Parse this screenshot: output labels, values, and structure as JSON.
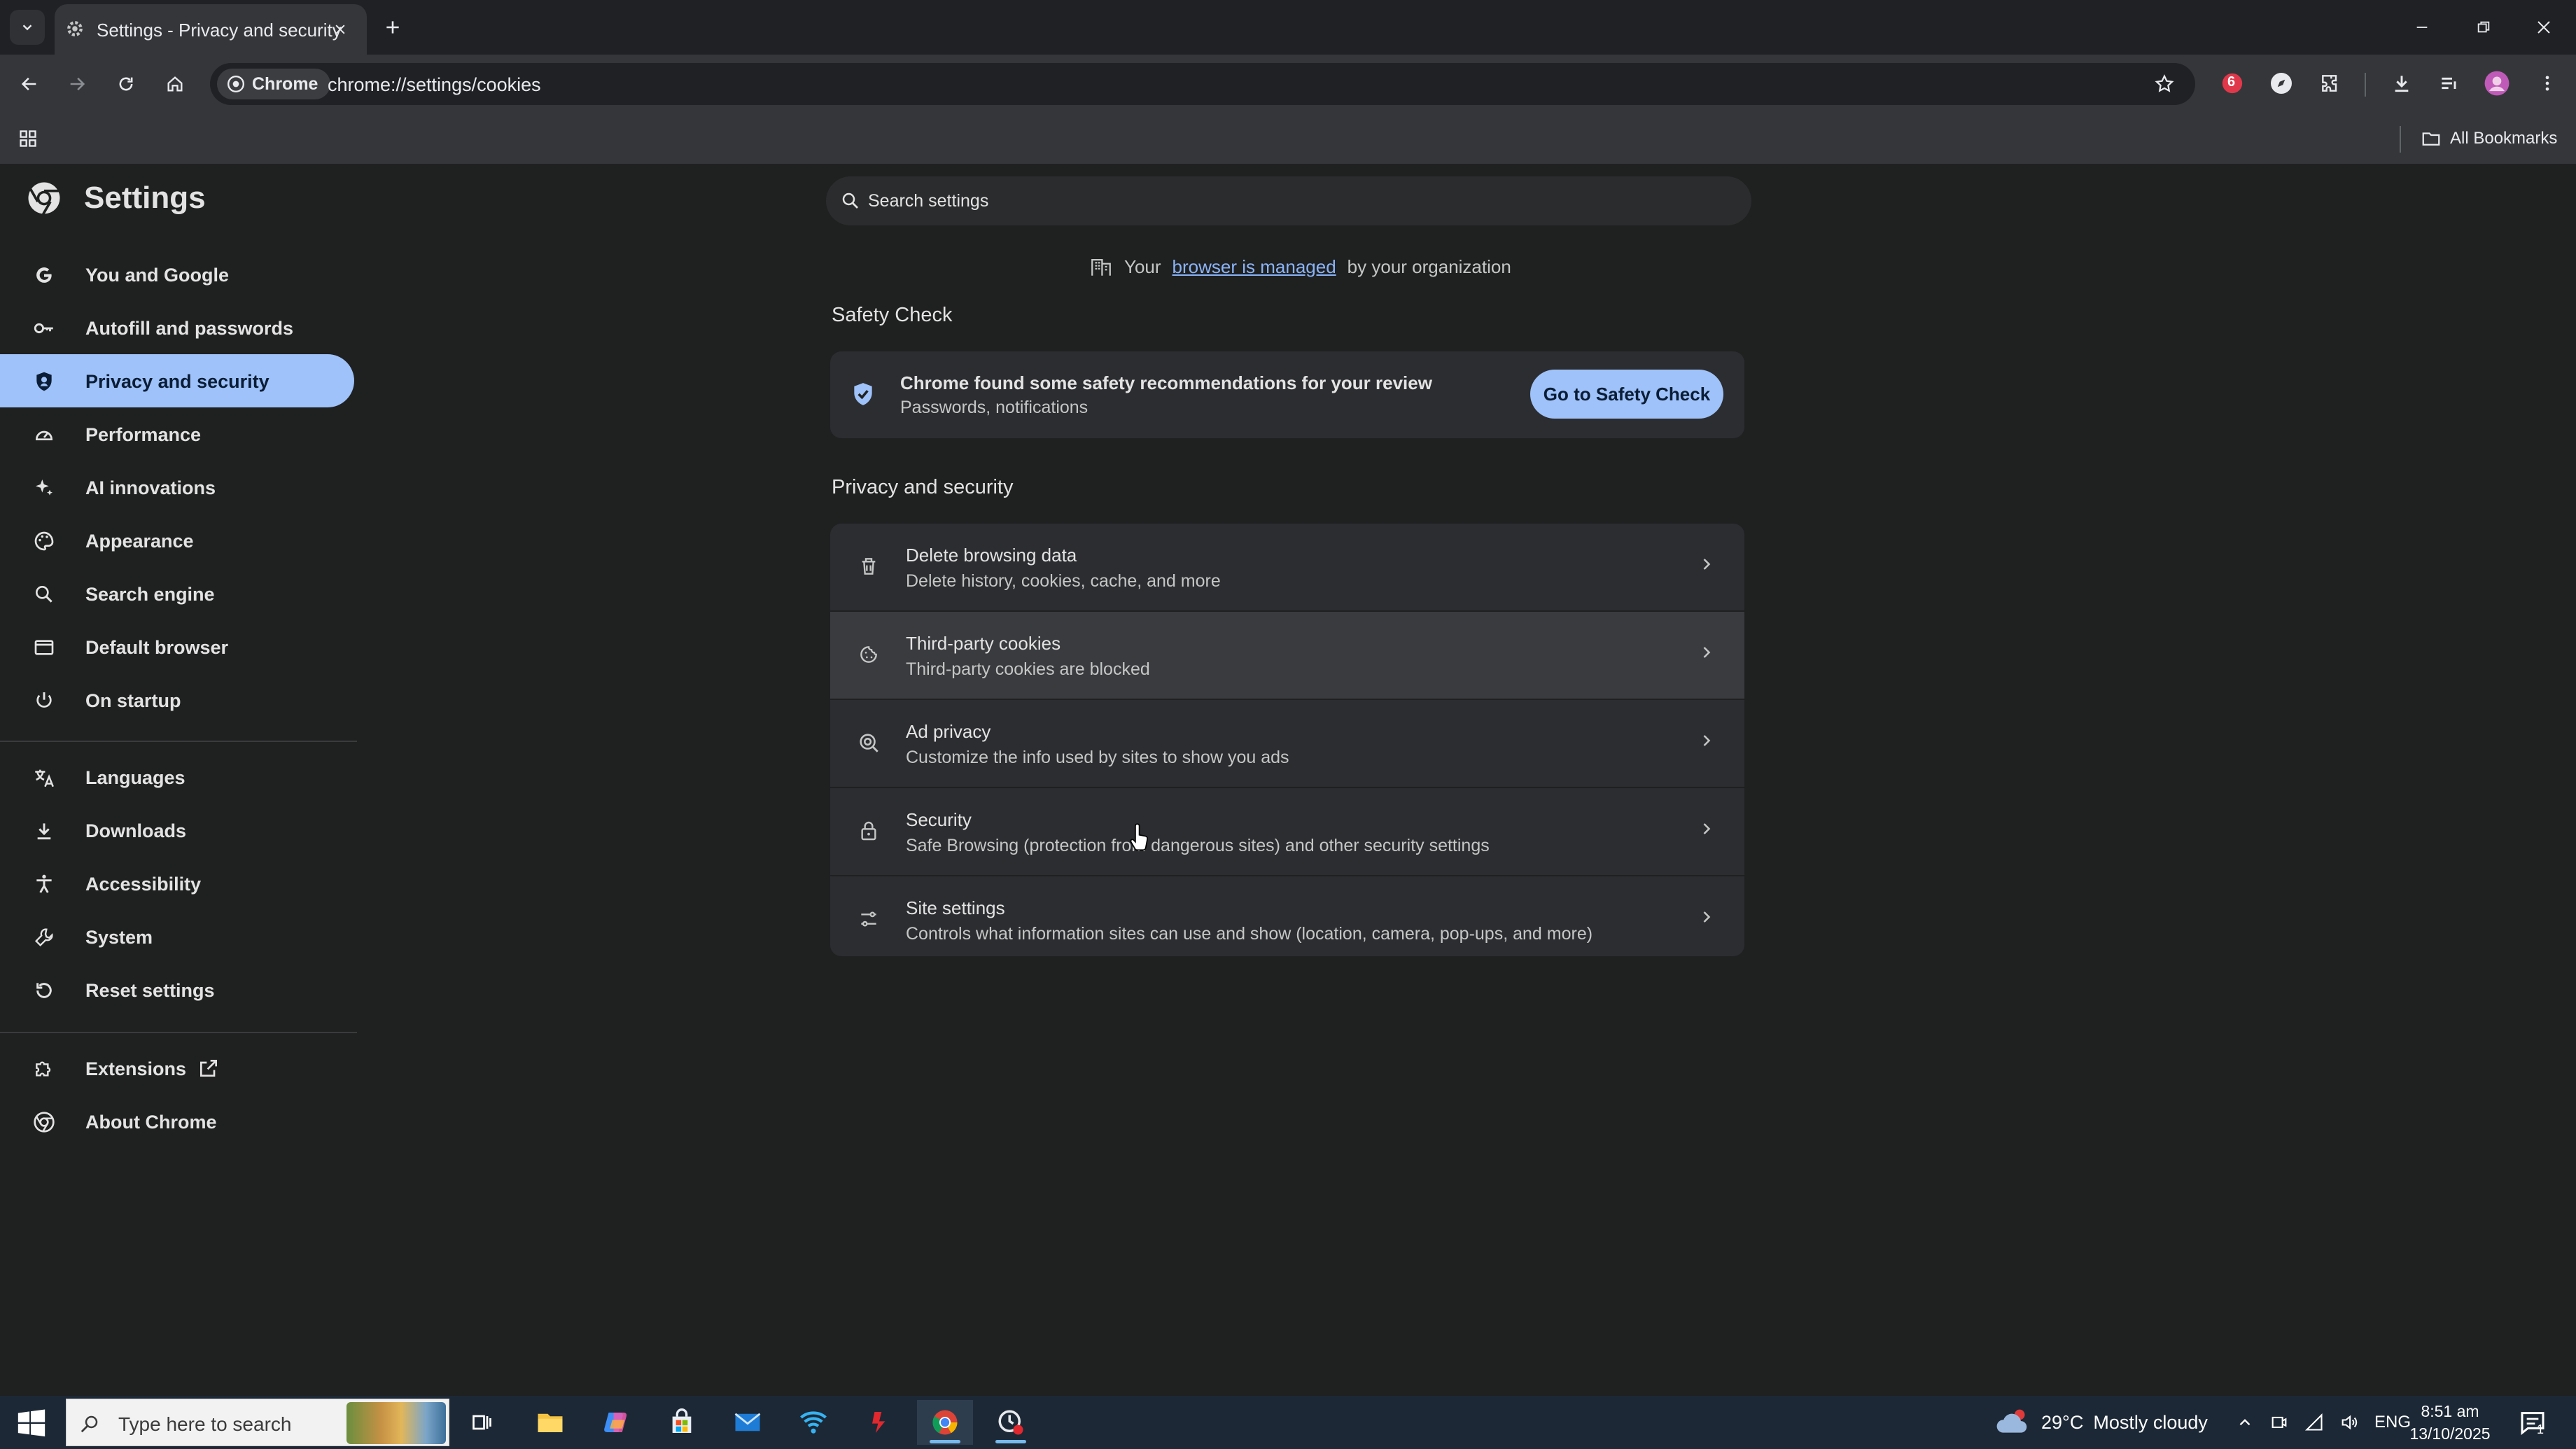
{
  "browser": {
    "tab": {
      "title": "Settings - Privacy and security"
    },
    "omnibox": {
      "chip": "Chrome",
      "url": "chrome://settings/cookies"
    },
    "bookmarks": {
      "all_bookmarks": "All Bookmarks"
    },
    "extension_badge": "6"
  },
  "settings": {
    "header_title": "Settings",
    "search_placeholder": "Search settings",
    "nav": [
      {
        "label": "You and Google",
        "icon": "google-icon"
      },
      {
        "label": "Autofill and passwords",
        "icon": "key-icon"
      },
      {
        "label": "Privacy and security",
        "icon": "shield-icon",
        "selected": true
      },
      {
        "label": "Performance",
        "icon": "gauge-icon"
      },
      {
        "label": "AI innovations",
        "icon": "sparkle-icon"
      },
      {
        "label": "Appearance",
        "icon": "palette-icon"
      },
      {
        "label": "Search engine",
        "icon": "search-icon"
      },
      {
        "label": "Default browser",
        "icon": "browser-window-icon"
      },
      {
        "label": "On startup",
        "icon": "power-icon"
      },
      {
        "label": "Languages",
        "icon": "translate-icon"
      },
      {
        "label": "Downloads",
        "icon": "download-icon"
      },
      {
        "label": "Accessibility",
        "icon": "accessibility-icon"
      },
      {
        "label": "System",
        "icon": "wrench-icon"
      },
      {
        "label": "Reset settings",
        "icon": "reset-icon"
      },
      {
        "label": "Extensions",
        "icon": "puzzle-icon"
      },
      {
        "label": "About Chrome",
        "icon": "chrome-icon"
      }
    ],
    "managed": {
      "prefix": "Your",
      "link": "browser is managed",
      "suffix": "by your organization"
    },
    "safety_check": {
      "section_title": "Safety Check",
      "title": "Chrome found some safety recommendations for your review",
      "subtitle": "Passwords, notifications",
      "button": "Go to Safety Check"
    },
    "privacy": {
      "section_title": "Privacy and security",
      "rows": [
        {
          "title": "Delete browsing data",
          "subtitle": "Delete history, cookies, cache, and more",
          "icon": "trash-icon"
        },
        {
          "title": "Third-party cookies",
          "subtitle": "Third-party cookies are blocked",
          "icon": "cookie-icon"
        },
        {
          "title": "Ad privacy",
          "subtitle": "Customize the info used by sites to show you ads",
          "icon": "ad-privacy-icon"
        },
        {
          "title": "Security",
          "subtitle": "Safe Browsing (protection from dangerous sites) and other security settings",
          "icon": "lock-icon"
        },
        {
          "title": "Site settings",
          "subtitle": "Controls what information sites can use and show (location, camera, pop-ups, and more)",
          "icon": "tune-icon"
        }
      ]
    }
  },
  "taskbar": {
    "search_placeholder": "Type here to search",
    "weather": {
      "temp": "29°C",
      "condition": "Mostly cloudy"
    },
    "language": "ENG",
    "time": "8:51 am",
    "date": "13/10/2025",
    "notifications": "1"
  },
  "colors": {
    "page_bg": "#1f2020",
    "card_bg": "#2c2d30",
    "accent": "#9ec2f9",
    "link": "#8ab4f8"
  }
}
